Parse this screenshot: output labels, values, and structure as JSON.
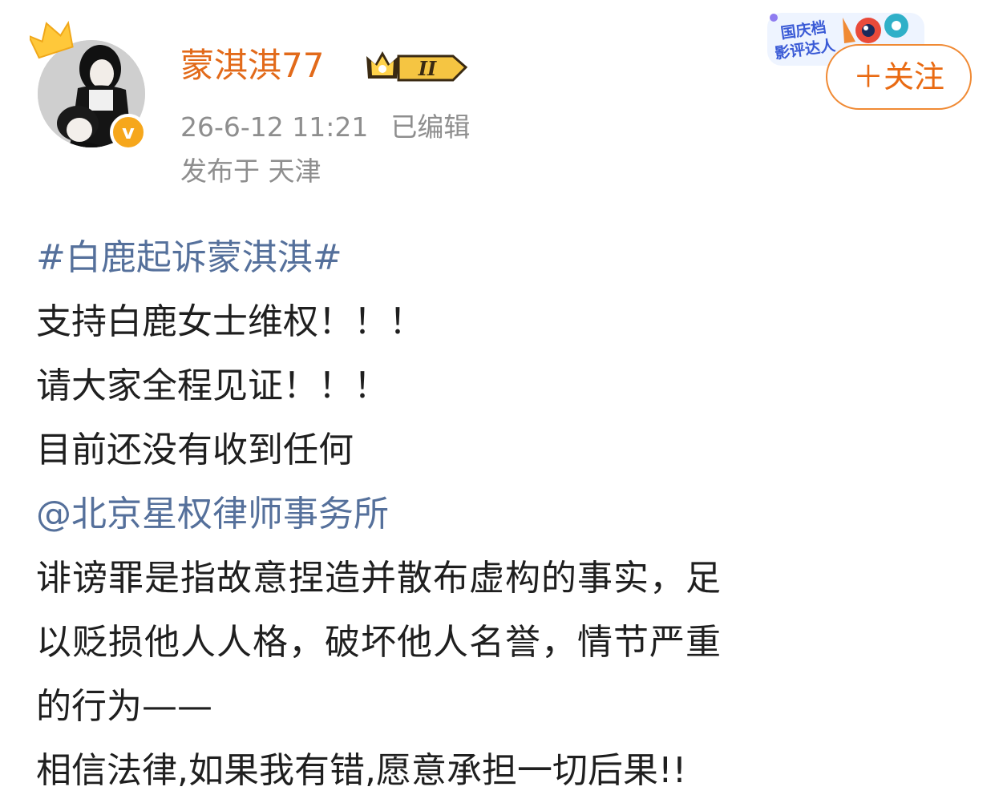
{
  "post": {
    "author": {
      "name": "蒙淇淇77",
      "level_badge": "II",
      "verified_mark": "v",
      "avatar_icon": "avatar-photo"
    },
    "time": "26-6-12 11:21",
    "edited": "已编辑",
    "location": "发布于 天津",
    "event_badge": {
      "text_line1": "国庆档",
      "text_line2": "影评达人"
    },
    "follow_label": "＋关注",
    "lines": [
      {
        "text": "#白鹿起诉蒙淇淇#",
        "kind": "hashtag"
      },
      {
        "text": "支持白鹿女士维权！！！",
        "kind": "text"
      },
      {
        "text": "请大家全程见证！！！",
        "kind": "text"
      },
      {
        "text": "目前还没有收到任何",
        "kind": "text"
      },
      {
        "text": "@北京星权律师事务所",
        "kind": "mention"
      },
      {
        "text": "诽谤罪是指故意捏造并散布虚构的事实，足",
        "kind": "text"
      },
      {
        "text": "以贬损他人人格，破坏他人名誉，情节严重",
        "kind": "text"
      },
      {
        "text": "的行为——",
        "kind": "text"
      },
      {
        "text": "相信法律,如果我有错,愿意承担一切后果!!",
        "kind": "text"
      }
    ]
  },
  "colors": {
    "username": "#e26a1a",
    "link": "#55709b",
    "meta": "#8e8e8e",
    "text": "#1f1f1f",
    "follow": "#e96a12",
    "verified": "#f6a71c"
  }
}
